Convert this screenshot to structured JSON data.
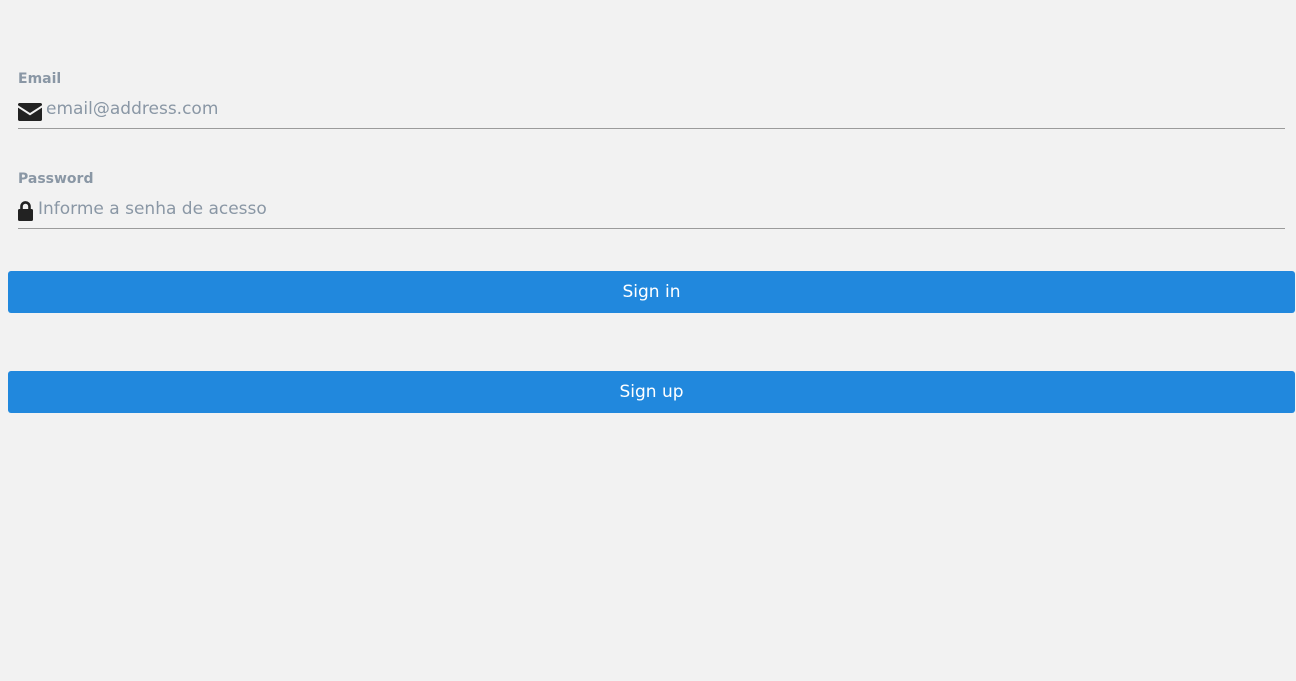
{
  "form": {
    "email": {
      "label": "Email",
      "icon": "envelope-icon",
      "value": "",
      "placeholder": "email@address.com"
    },
    "password": {
      "label": "Password",
      "icon": "lock-icon",
      "value": "",
      "placeholder": "Informe a senha de acesso"
    }
  },
  "actions": {
    "sign_in_label": "Sign in",
    "sign_up_label": "Sign up"
  },
  "colors": {
    "background": "#f2f2f2",
    "button": "#2188dd",
    "button_text": "#ffffff",
    "label": "#8a97a5",
    "icon": "#222222",
    "underline": "#9b9b9b"
  }
}
